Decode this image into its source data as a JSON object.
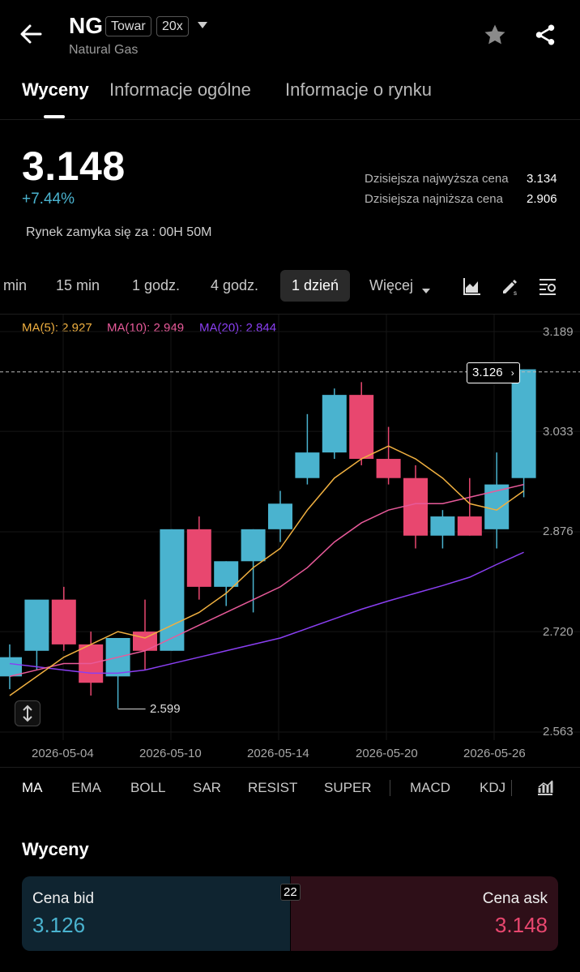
{
  "header": {
    "symbol": "NG",
    "tag_type": "Towar",
    "tag_leverage": "20x",
    "subtitle": "Natural Gas"
  },
  "tabs": [
    {
      "label": "Wyceny"
    },
    {
      "label": "Informacje ogólne"
    },
    {
      "label": "Informacje o rynku"
    }
  ],
  "price": {
    "last": "3.148",
    "change": "+7.44%",
    "high_label": "Dzisiejsza najwyższa cena",
    "high_value": "3.134",
    "low_label": "Dzisiejsza najniższa cena",
    "low_value": "2.906",
    "market_close": "Rynek zamyka się za : 00H 50M"
  },
  "timeframes": [
    {
      "label": "min"
    },
    {
      "label": "15 min"
    },
    {
      "label": "1 godz."
    },
    {
      "label": "4 godz."
    },
    {
      "label": "1 dzień"
    },
    {
      "label": "Więcej"
    }
  ],
  "ma_legend": {
    "ma5": "MA(5): 2.927",
    "ma10": "MA(10): 2.949",
    "ma20": "MA(20): 2.844"
  },
  "chart_data": {
    "type": "candlestick",
    "y_ticks": [
      "3.189",
      "3.033",
      "2.876",
      "2.720",
      "2.563"
    ],
    "x_ticks": [
      "2026-05-04",
      "2026-05-10",
      "2026-05-14",
      "2026-05-20",
      "2026-05-26"
    ],
    "last_price_label": "3.126",
    "min_label": "2.599",
    "candles": [
      {
        "o": 2.65,
        "h": 2.7,
        "l": 2.63,
        "c": 2.68
      },
      {
        "o": 2.69,
        "h": 2.75,
        "l": 2.66,
        "c": 2.77
      },
      {
        "o": 2.77,
        "h": 2.79,
        "l": 2.69,
        "c": 2.7
      },
      {
        "o": 2.7,
        "h": 2.72,
        "l": 2.62,
        "c": 2.64
      },
      {
        "o": 2.65,
        "h": 2.71,
        "l": 2.6,
        "c": 2.71
      },
      {
        "o": 2.72,
        "h": 2.77,
        "l": 2.66,
        "c": 2.69
      },
      {
        "o": 2.69,
        "h": 2.88,
        "l": 2.69,
        "c": 2.88
      },
      {
        "o": 2.88,
        "h": 2.9,
        "l": 2.77,
        "c": 2.79
      },
      {
        "o": 2.79,
        "h": 2.83,
        "l": 2.76,
        "c": 2.83
      },
      {
        "o": 2.83,
        "h": 2.88,
        "l": 2.75,
        "c": 2.88
      },
      {
        "o": 2.88,
        "h": 2.94,
        "l": 2.86,
        "c": 2.92
      },
      {
        "o": 2.96,
        "h": 3.06,
        "l": 2.95,
        "c": 3.0
      },
      {
        "o": 3.0,
        "h": 3.1,
        "l": 2.99,
        "c": 3.09
      },
      {
        "o": 3.09,
        "h": 3.11,
        "l": 2.98,
        "c": 2.99
      },
      {
        "o": 2.99,
        "h": 3.04,
        "l": 2.95,
        "c": 2.96
      },
      {
        "o": 2.96,
        "h": 2.98,
        "l": 2.85,
        "c": 2.87
      },
      {
        "o": 2.87,
        "h": 2.91,
        "l": 2.85,
        "c": 2.9
      },
      {
        "o": 2.9,
        "h": 2.96,
        "l": 2.87,
        "c": 2.87
      },
      {
        "o": 2.88,
        "h": 3.0,
        "l": 2.85,
        "c": 2.95
      },
      {
        "o": 2.96,
        "h": 3.13,
        "l": 2.93,
        "c": 3.13
      }
    ],
    "ma5": [
      2.62,
      2.65,
      2.68,
      2.7,
      2.72,
      2.71,
      2.73,
      2.75,
      2.78,
      2.82,
      2.85,
      2.91,
      2.96,
      2.99,
      3.01,
      2.99,
      2.96,
      2.92,
      2.91,
      2.94
    ],
    "ma10": [
      2.65,
      2.66,
      2.67,
      2.67,
      2.68,
      2.69,
      2.71,
      2.73,
      2.75,
      2.77,
      2.79,
      2.82,
      2.86,
      2.89,
      2.91,
      2.92,
      2.92,
      2.93,
      2.94,
      2.95
    ],
    "ma20": [
      2.67,
      2.665,
      2.66,
      2.655,
      2.655,
      2.66,
      2.67,
      2.68,
      2.69,
      2.7,
      2.71,
      2.725,
      2.74,
      2.755,
      2.768,
      2.78,
      2.792,
      2.805,
      2.825,
      2.844
    ],
    "ylim": [
      2.563,
      3.189
    ],
    "colors": {
      "up": "#4ab3cf",
      "down": "#e8476f",
      "ma5": "#f0b040",
      "ma10": "#e85a9a",
      "ma20": "#8a3ff2"
    }
  },
  "indicators": [
    {
      "label": "MA"
    },
    {
      "label": "EMA"
    },
    {
      "label": "BOLL"
    },
    {
      "label": "SAR"
    },
    {
      "label": "RESIST"
    },
    {
      "label": "SUPER"
    },
    {
      "label": "MACD"
    },
    {
      "label": "KDJ"
    }
  ],
  "quotes": {
    "title": "Wyceny",
    "bid_label": "Cena bid",
    "bid_value": "3.126",
    "ask_label": "Cena ask",
    "ask_value": "3.148",
    "spread": "22"
  }
}
